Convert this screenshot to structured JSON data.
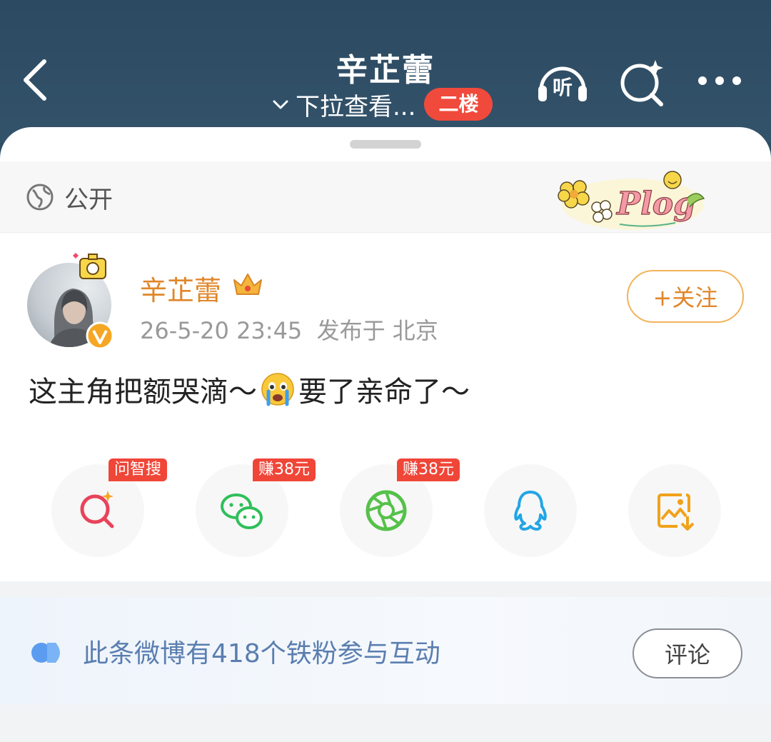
{
  "header": {
    "title": "辛芷蕾",
    "subtitle": "下拉查看...",
    "floor_badge": "二楼",
    "listen_label": "听"
  },
  "visibility": {
    "label": "公开"
  },
  "sticker": {
    "text": "Plog"
  },
  "post": {
    "username": "辛芷蕾",
    "timestamp": "26-5-20 23:45",
    "location": "发布于 北京",
    "follow_label": "+关注",
    "text_before_emoji": "这主角把额哭滴～",
    "text_after_emoji": "要了亲命了～"
  },
  "share": {
    "items": [
      {
        "icon": "ai-search-icon",
        "badge": "问智搜",
        "color": "#e8435a"
      },
      {
        "icon": "wechat-icon",
        "badge": "赚38元",
        "color": "#2fbf5b"
      },
      {
        "icon": "moments-icon",
        "badge": "赚38元",
        "color": "#55c14a"
      },
      {
        "icon": "qq-icon",
        "badge": "",
        "color": "#22a5e6"
      },
      {
        "icon": "save-image-icon",
        "badge": "",
        "color": "#f0a21a"
      }
    ]
  },
  "fans": {
    "text": "此条微博有418个铁粉参与互动",
    "comment_label": "评论"
  },
  "colors": {
    "header_bg": "#2f4d63",
    "accent_orange": "#e0862a",
    "badge_red": "#f04638",
    "fans_blue": "#5a7eb0"
  }
}
